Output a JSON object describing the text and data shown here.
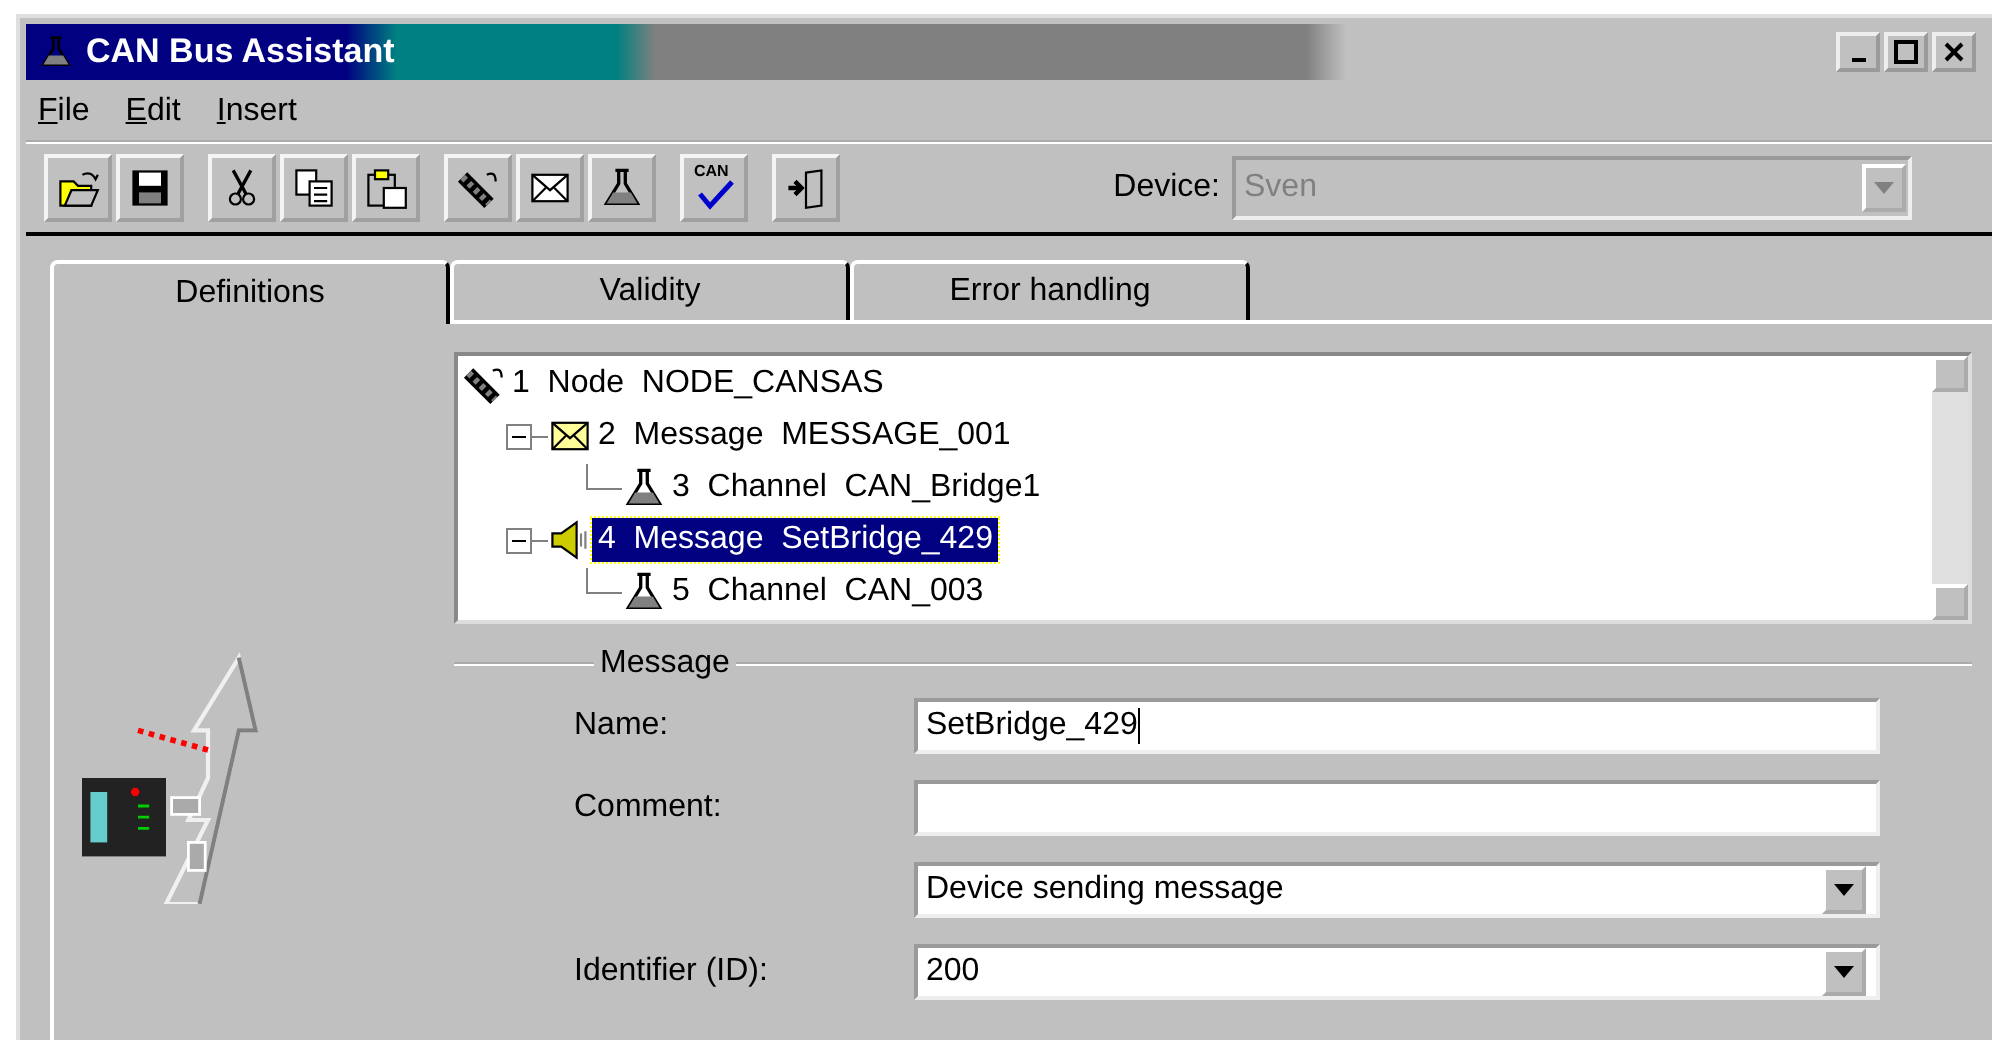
{
  "window": {
    "title": "CAN Bus Assistant"
  },
  "menu": [
    {
      "label": "File"
    },
    {
      "label": "Edit"
    },
    {
      "label": "Insert"
    }
  ],
  "toolbar": [
    [
      {
        "kind": "open"
      },
      {
        "kind": "save"
      }
    ],
    [
      {
        "kind": "cut"
      },
      {
        "kind": "copy"
      },
      {
        "kind": "paste"
      }
    ],
    [
      {
        "kind": "node"
      },
      {
        "kind": "mail"
      },
      {
        "kind": "flask"
      }
    ],
    [
      {
        "kind": "validate",
        "label": "CAN"
      }
    ],
    [
      {
        "kind": "exit"
      }
    ]
  ],
  "device": {
    "label": "Device:",
    "value": "Sven",
    "disabled": true
  },
  "tabs": [
    {
      "label": "Definitions",
      "selected": true
    },
    {
      "label": "Validity",
      "selected": false
    },
    {
      "label": "Error handling",
      "selected": false
    }
  ],
  "tree": [
    {
      "kind": "node",
      "label": "1  Node  NODE_CANSAS",
      "selected": false,
      "children": [
        {
          "kind": "mail",
          "label": "2  Message  MESSAGE_001",
          "selected": false,
          "expanded": true,
          "children": [
            {
              "kind": "channel",
              "label": "3  Channel  CAN_Bridge1",
              "selected": false
            }
          ]
        },
        {
          "kind": "speaker",
          "label": "4  Message  SetBridge_429",
          "selected": true,
          "expanded": true,
          "children": [
            {
              "kind": "channel",
              "label": "5  Channel  CAN_003",
              "selected": false
            }
          ]
        }
      ]
    }
  ],
  "group": {
    "title": "Message",
    "fields": [
      {
        "kind": "text",
        "label": "Name:",
        "value": "SetBridge_429",
        "focused": true
      },
      {
        "kind": "text",
        "label": "Comment:",
        "focused": false
      },
      {
        "kind": "select",
        "value": "Device sending message"
      },
      {
        "kind": "select",
        "label": "Identifier (ID):",
        "value": "200"
      }
    ]
  }
}
